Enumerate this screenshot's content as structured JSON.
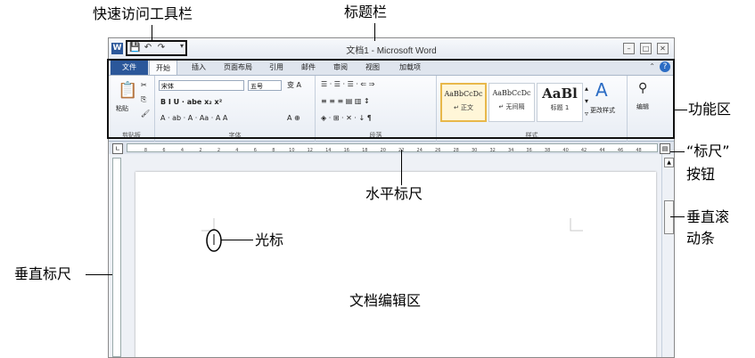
{
  "window": {
    "app_icon": "W",
    "title": "文档1 - Microsoft Word",
    "controls": [
      "–",
      "□",
      "✕"
    ]
  },
  "quick_access": {
    "icons": [
      "save-icon",
      "undo-icon",
      "redo-icon"
    ],
    "glyphs": [
      "💾",
      "↶",
      "↷"
    ],
    "dropdown": "▾"
  },
  "tabs": [
    "文件",
    "开始",
    "插入",
    "页面布局",
    "引用",
    "邮件",
    "审阅",
    "视图",
    "加载项"
  ],
  "ribbon": {
    "clipboard": {
      "paste": "粘贴",
      "label": "剪贴板"
    },
    "font": {
      "font_name": "宋体",
      "font_size": "五号",
      "label": "字体",
      "row2": "B  I  U · abe  x₂  x²",
      "row3": "A · ab · A · Aa ·  A  A"
    },
    "paragraph": {
      "label": "段落",
      "row1": "☰ · ☰ · ☰ ·  ⇐  ⇒",
      "row2": "≡  ≡  ≡  ▤  ▥  ↕",
      "row3": "◈ · ⊞ ·  ✕ ·  ↓  ¶"
    },
    "styles": {
      "label": "样式",
      "items": [
        {
          "sample": "AaBbCcDc",
          "name": "↵ 正文"
        },
        {
          "sample": "AaBbCcDc",
          "name": "↵ 无间隔"
        },
        {
          "sample": "AaBl",
          "name": "标题 1"
        }
      ],
      "change_styles": "更改样式",
      "change_styles_glyph": "A"
    },
    "editing": {
      "label": "编辑",
      "glyph": "⚲"
    }
  },
  "ruler": {
    "ticks": [
      "8",
      "6",
      "4",
      "2",
      "2",
      "4",
      "6",
      "8",
      "10",
      "12",
      "14",
      "16",
      "18",
      "20",
      "22",
      "24",
      "26",
      "28",
      "30",
      "32",
      "34",
      "36",
      "38",
      "40",
      "42",
      "44",
      "46",
      "48"
    ]
  },
  "annotations": {
    "quick_access": "快速访问工具栏",
    "title_bar": "标题栏",
    "ribbon": "功能区",
    "ruler_button_1": "“标尺”",
    "ruler_button_2": "按钮",
    "horizontal_ruler": "水平标尺",
    "vertical_scroll_1": "垂直滚",
    "vertical_scroll_2": "动条",
    "cursor": "光标",
    "vertical_ruler": "垂直标尺",
    "doc_area": "文档编辑区"
  }
}
